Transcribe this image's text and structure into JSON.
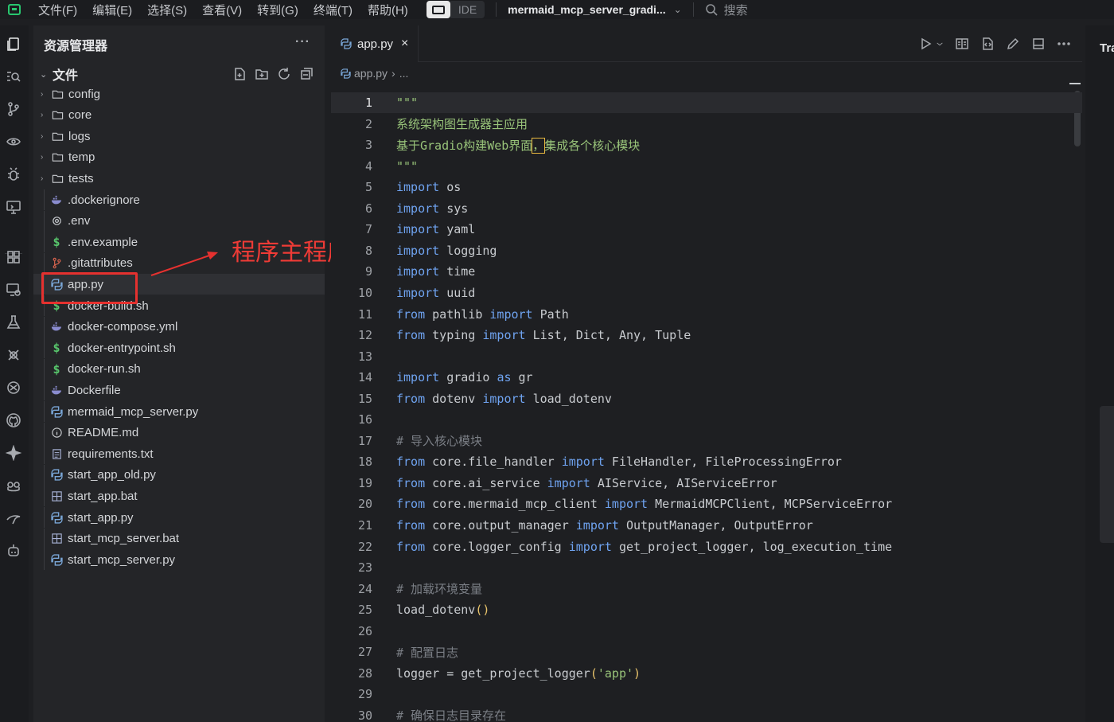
{
  "menubar": {
    "items": [
      "文件(F)",
      "编辑(E)",
      "选择(S)",
      "查看(V)",
      "转到(G)",
      "终端(T)",
      "帮助(H)"
    ],
    "ide_label": "IDE",
    "project_name": "mermaid_mcp_server_gradi...",
    "search_placeholder": "搜索"
  },
  "sidebar": {
    "title": "资源管理器",
    "section_label": "文件",
    "items": [
      {
        "name": "config",
        "type": "folder"
      },
      {
        "name": "core",
        "type": "folder"
      },
      {
        "name": "logs",
        "type": "folder"
      },
      {
        "name": "temp",
        "type": "folder"
      },
      {
        "name": "tests",
        "type": "folder"
      },
      {
        "name": ".dockerignore",
        "type": "docker"
      },
      {
        "name": ".env",
        "type": "gear"
      },
      {
        "name": ".env.example",
        "type": "dollar"
      },
      {
        "name": ".gitattributes",
        "type": "git"
      },
      {
        "name": "app.py",
        "type": "python"
      },
      {
        "name": "docker-build.sh",
        "type": "dollar"
      },
      {
        "name": "docker-compose.yml",
        "type": "docker"
      },
      {
        "name": "docker-entrypoint.sh",
        "type": "dollar"
      },
      {
        "name": "docker-run.sh",
        "type": "dollar"
      },
      {
        "name": "Dockerfile",
        "type": "docker"
      },
      {
        "name": "mermaid_mcp_server.py",
        "type": "python"
      },
      {
        "name": "README.md",
        "type": "info"
      },
      {
        "name": "requirements.txt",
        "type": "text"
      },
      {
        "name": "start_app_old.py",
        "type": "python"
      },
      {
        "name": "start_app.bat",
        "type": "windows"
      },
      {
        "name": "start_app.py",
        "type": "python"
      },
      {
        "name": "start_mcp_server.bat",
        "type": "windows"
      },
      {
        "name": "start_mcp_server.py",
        "type": "python"
      }
    ]
  },
  "annotation": {
    "text": "程序主程序app.py",
    "color": "#e5312f"
  },
  "editor": {
    "tab_label": "app.py",
    "breadcrumb": [
      "app.py",
      "..."
    ],
    "current_line": 1,
    "lines": [
      [
        [
          "doc",
          "\"\"\""
        ]
      ],
      [
        [
          "doc",
          "系统架构图生成器主应用"
        ]
      ],
      [
        [
          "doc",
          "基于Gradio构建Web界面"
        ],
        [
          "cursor",
          "，"
        ],
        [
          "doc",
          "集成各个核心模块"
        ]
      ],
      [
        [
          "doc",
          "\"\"\""
        ]
      ],
      [
        [
          "kw",
          "import"
        ],
        [
          "txt",
          " os"
        ]
      ],
      [
        [
          "kw",
          "import"
        ],
        [
          "txt",
          " sys"
        ]
      ],
      [
        [
          "kw",
          "import"
        ],
        [
          "txt",
          " yaml"
        ]
      ],
      [
        [
          "kw",
          "import"
        ],
        [
          "txt",
          " logging"
        ]
      ],
      [
        [
          "kw",
          "import"
        ],
        [
          "txt",
          " time"
        ]
      ],
      [
        [
          "kw",
          "import"
        ],
        [
          "txt",
          " uuid"
        ]
      ],
      [
        [
          "kw",
          "from"
        ],
        [
          "txt",
          " pathlib "
        ],
        [
          "kw",
          "import"
        ],
        [
          "txt",
          " Path"
        ]
      ],
      [
        [
          "kw",
          "from"
        ],
        [
          "txt",
          " typing "
        ],
        [
          "kw",
          "import"
        ],
        [
          "txt",
          " List, Dict, Any, Tuple"
        ]
      ],
      [],
      [
        [
          "kw",
          "import"
        ],
        [
          "txt",
          " gradio "
        ],
        [
          "kw",
          "as"
        ],
        [
          "txt",
          " gr"
        ]
      ],
      [
        [
          "kw",
          "from"
        ],
        [
          "txt",
          " dotenv "
        ],
        [
          "kw",
          "import"
        ],
        [
          "txt",
          " load_dotenv"
        ]
      ],
      [],
      [
        [
          "cmt",
          "# 导入核心模块"
        ]
      ],
      [
        [
          "kw",
          "from"
        ],
        [
          "txt",
          " core.file_handler "
        ],
        [
          "kw",
          "import"
        ],
        [
          "txt",
          " FileHandler, FileProcessingError"
        ]
      ],
      [
        [
          "kw",
          "from"
        ],
        [
          "txt",
          " core.ai_service "
        ],
        [
          "kw",
          "import"
        ],
        [
          "txt",
          " AIService, AIServiceError"
        ]
      ],
      [
        [
          "kw",
          "from"
        ],
        [
          "txt",
          " core.mermaid_mcp_client "
        ],
        [
          "kw",
          "import"
        ],
        [
          "txt",
          " MermaidMCPClient, MCPServiceError"
        ]
      ],
      [
        [
          "kw",
          "from"
        ],
        [
          "txt",
          " core.output_manager "
        ],
        [
          "kw",
          "import"
        ],
        [
          "txt",
          " OutputManager, OutputError"
        ]
      ],
      [
        [
          "kw",
          "from"
        ],
        [
          "txt",
          " core.logger_config "
        ],
        [
          "kw",
          "import"
        ],
        [
          "txt",
          " get_project_logger, log_execution_time"
        ]
      ],
      [],
      [
        [
          "cmt",
          "# 加载环境变量"
        ]
      ],
      [
        [
          "txt",
          "load_dotenv"
        ],
        [
          "par",
          "()"
        ]
      ],
      [],
      [
        [
          "cmt",
          "# 配置日志"
        ]
      ],
      [
        [
          "txt",
          "logger = get_project_logger"
        ],
        [
          "par",
          "("
        ],
        [
          "str",
          "'app'"
        ],
        [
          "par",
          ")"
        ]
      ],
      [],
      [
        [
          "cmt",
          "# 确保日志目录存在"
        ]
      ]
    ]
  },
  "right_panel": {
    "label": "Tra"
  }
}
